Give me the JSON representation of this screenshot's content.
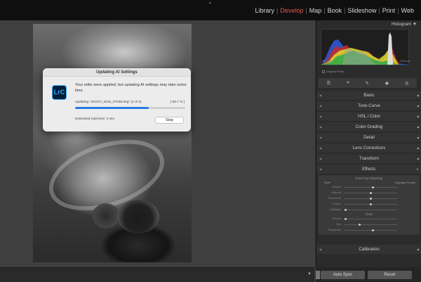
{
  "modules": [
    "Library",
    "Develop",
    "Map",
    "Book",
    "Slideshow",
    "Print",
    "Web"
  ],
  "active_module": "Develop",
  "dialog": {
    "title": "Updating AI Settings",
    "icon_text": "LrC",
    "message": "Your edits were applied, but updating AI settings may take some time.",
    "file_label": "Updating \"JKOST_2016_07039.dng\" (3 of 3)",
    "percent_label": "[ 66.7 % ]",
    "progress": 66.7,
    "eta": "Estimated total time: 2 sec",
    "stop_label": "Stop"
  },
  "right_panel": {
    "histogram_label": "Histogram",
    "histogram_readouts": [
      "ISO 400",
      "24 mm",
      "f / 11",
      "1/100 sec"
    ],
    "original_photo_label": "Original Photo",
    "sections": [
      "Basic",
      "Tone Curve",
      "HSL / Color",
      "Color Grading",
      "Detail",
      "Lens Corrections",
      "Transform",
      "Effects"
    ],
    "effects": {
      "vignette_title": "Post-Crop Vignetting",
      "style_label": "Style",
      "style_value": "Highlight Priority",
      "vignette_sliders": [
        {
          "label": "Amount",
          "value": 0.55
        },
        {
          "label": "Midpoint",
          "value": 0.5
        },
        {
          "label": "Roundness",
          "value": 0.5
        },
        {
          "label": "Feather",
          "value": 0.5
        },
        {
          "label": "Highlights",
          "value": 0.03
        }
      ],
      "grain_title": "Grain",
      "grain_sliders": [
        {
          "label": "Amount",
          "value": 0.03
        },
        {
          "label": "Size",
          "value": 0.3
        },
        {
          "label": "Roughness",
          "value": 0.55
        }
      ]
    },
    "calibration_label": "Calibration",
    "sync_label": "Auto Sync",
    "reset_label": "Reset"
  },
  "icons": [
    "histogram-icon",
    "crop-icon",
    "healing-icon",
    "redeye-icon",
    "mask-icon"
  ]
}
